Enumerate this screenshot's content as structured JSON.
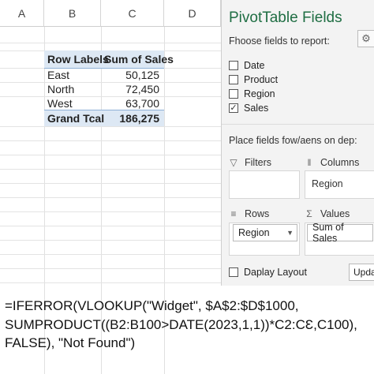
{
  "sheet": {
    "columns": [
      "A",
      "B",
      "C",
      "D"
    ],
    "pivot": {
      "header": {
        "row_labels": "Row Labels",
        "sum_of_sales": "Sum of Sales"
      },
      "rows": [
        {
          "label": "East",
          "value": "50,125"
        },
        {
          "label": "North",
          "value": "72,450"
        },
        {
          "label": "West",
          "value": "63,700"
        }
      ],
      "total": {
        "label": "Grand Tcal",
        "value": "186,275"
      }
    }
  },
  "pane": {
    "title": "PivotTable Fields",
    "subtitle": "Fhoose fields to report:",
    "gear_icon": "gear-icon",
    "fields": [
      {
        "label": "Date",
        "checked": false
      },
      {
        "label": "Product",
        "checked": false
      },
      {
        "label": "Region",
        "checked": false
      },
      {
        "label": "Sales",
        "checked": true
      }
    ],
    "drag_title": "Place fields fow/aens on dep:",
    "areas": {
      "filters": {
        "label": "Filters",
        "icon": "filter-icon"
      },
      "columns": {
        "label": "Columns",
        "icon": "columns-icon",
        "item": "Region"
      },
      "rows": {
        "label": "Rows",
        "icon": "rows-icon",
        "item": "Region"
      },
      "values": {
        "label": "Values",
        "icon": "sigma-icon",
        "item": "Sum of Sales"
      }
    },
    "defer_label": "Daplay Layout",
    "update_label": "Upda"
  },
  "formula": {
    "line1": "=IFERROR(VLOOKUP(\"Widget\", $A$2:$D$1000,",
    "line2": "SUMPRODUCT((B2:B100>DATE(2023,1,1))*C2:CƐ,C100),",
    "line3": "FALSE), \"Not Found\")"
  }
}
